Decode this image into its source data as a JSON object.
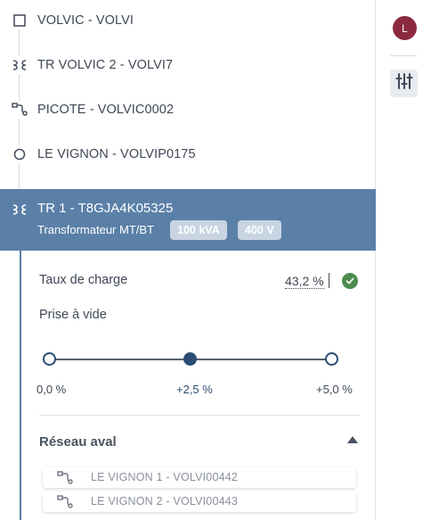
{
  "tree": {
    "items": [
      {
        "label": "VOLVIC - VOLVI",
        "icon": "square-node-icon"
      },
      {
        "label": "TR VOLVIC 2 - VOLVI7",
        "icon": "transformer-icon"
      },
      {
        "label": "PICOTE - VOLVIC0002",
        "icon": "branch-icon"
      },
      {
        "label": "LE VIGNON - VOLVIP0175",
        "icon": "circle-node-icon"
      }
    ],
    "selected": {
      "title": "TR 1 - T8GJA4K05325",
      "subtitle": "Transformateur MT/BT",
      "badges": [
        "100 kVA",
        "400 V"
      ],
      "icon": "transformer-icon"
    }
  },
  "detail": {
    "charge_label": "Taux de charge",
    "charge_value": "43,2 %",
    "charge_status": "ok",
    "tap_label": "Prise à vide",
    "tap_options": [
      "0,0 %",
      "+2,5 %",
      "+5,0 %"
    ],
    "tap_selected_index": 1,
    "downstream_title": "Réseau aval",
    "downstream_items": [
      {
        "label": "LE VIGNON 1 - VOLVI00442"
      },
      {
        "label": "LE VIGNON 2 - VOLVI00443"
      }
    ]
  },
  "rail": {
    "avatar_initial": "L"
  },
  "colors": {
    "selected_bg": "#5b80a8",
    "accent_dark": "#2b4c74",
    "ok_green": "#4a8b4f",
    "avatar": "#8c2a3f"
  }
}
